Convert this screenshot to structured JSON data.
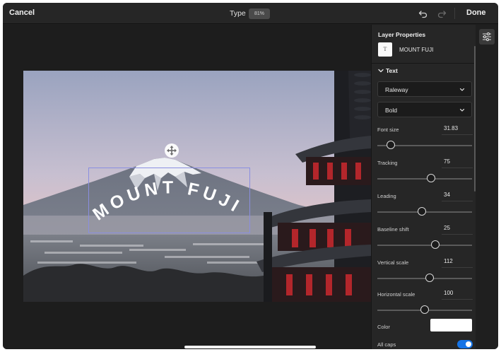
{
  "topbar": {
    "cancel_label": "Cancel",
    "type_label": "Type",
    "zoom_value": "81%",
    "done_label": "Done"
  },
  "canvas": {
    "layer_text": "MOUNT FUJI"
  },
  "panel": {
    "title": "Layer Properties",
    "layer_name": "MOUNT FUJI",
    "layer_thumb_glyph": "T",
    "section_label": "Text",
    "font_family": "Raleway",
    "font_weight": "Bold",
    "properties": [
      {
        "label": "Font size",
        "value": "31.83",
        "slider_fraction": 0.14
      },
      {
        "label": "Tracking",
        "value": "75",
        "slider_fraction": 0.57
      },
      {
        "label": "Leading",
        "value": "34",
        "slider_fraction": 0.47
      },
      {
        "label": "Baseline shift",
        "value": "25",
        "slider_fraction": 0.61
      },
      {
        "label": "Vertical scale",
        "value": "112",
        "slider_fraction": 0.55
      },
      {
        "label": "Horizontal scale",
        "value": "100",
        "slider_fraction": 0.5
      }
    ],
    "color_label": "Color",
    "text_color": "#ffffff",
    "all_caps_label": "All caps",
    "all_caps_on": true
  },
  "colors": {
    "accent": "#1473e6",
    "selection": "#8a8ee0",
    "panel_bg": "#262626"
  },
  "icons": {
    "undo": "undo-icon",
    "redo": "redo-icon",
    "move": "move-icon",
    "properties": "sliders-icon"
  }
}
